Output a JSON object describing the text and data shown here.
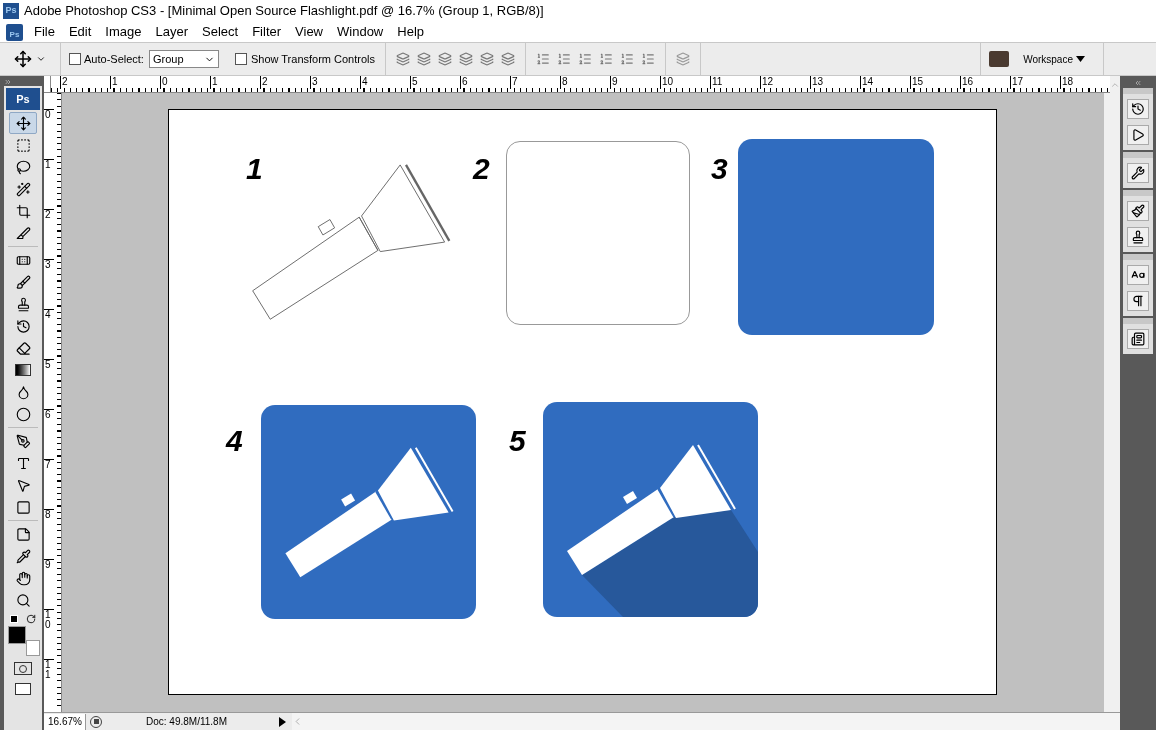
{
  "window": {
    "logo": "Ps",
    "title": "Adobe Photoshop CS3 - [Minimal Open Source Flashlight.pdf @ 16.7% (Group 1, RGB/8)]"
  },
  "menu_logo": "Ps",
  "toolbox_logo": "Ps",
  "menu": [
    "File",
    "Edit",
    "Image",
    "Layer",
    "Select",
    "Filter",
    "View",
    "Window",
    "Help"
  ],
  "options_bar": {
    "auto_select": {
      "label": "Auto-Select:",
      "checked": false
    },
    "auto_select_target": "Group",
    "show_transform_controls": {
      "label": "Show Transform Controls",
      "checked": false
    },
    "workspace": "Workspace"
  },
  "rulers": {
    "horizontal": [
      "2",
      "1",
      "0",
      "1",
      "2",
      "3",
      "4",
      "5",
      "6",
      "7",
      "8",
      "9",
      "10",
      "11",
      "12",
      "13",
      "14",
      "15",
      "16",
      "17",
      "18"
    ],
    "vertical": [
      "0",
      "1",
      "2",
      "3",
      "4",
      "5",
      "6",
      "7",
      "8",
      "9",
      "10",
      "11"
    ]
  },
  "tools": [
    {
      "selected": true
    },
    {
      "selected": false
    },
    {
      "selected": false
    },
    {
      "selected": false
    },
    {
      "selected": false
    },
    {
      "selected": false
    },
    {
      "selected": false
    },
    {
      "selected": false
    },
    {
      "selected": false
    },
    {
      "selected": false
    },
    {
      "selected": false
    },
    {
      "selected": false
    },
    {
      "selected": false
    },
    {
      "selected": false
    },
    {
      "selected": false
    },
    {
      "selected": false
    },
    {
      "selected": false
    },
    {
      "selected": false
    },
    {
      "selected": false
    },
    {
      "selected": false
    },
    {
      "selected": false
    },
    {
      "selected": false
    }
  ],
  "artboards": [
    {
      "number": "1",
      "kind": "sketch"
    },
    {
      "number": "2",
      "kind": "frame"
    },
    {
      "number": "3",
      "kind": "tile"
    },
    {
      "number": "4",
      "kind": "icon"
    },
    {
      "number": "5",
      "kind": "shadowed"
    }
  ],
  "status_bar": {
    "zoom": "16.67%",
    "doc": "Doc: 49.8M/11.8M"
  }
}
